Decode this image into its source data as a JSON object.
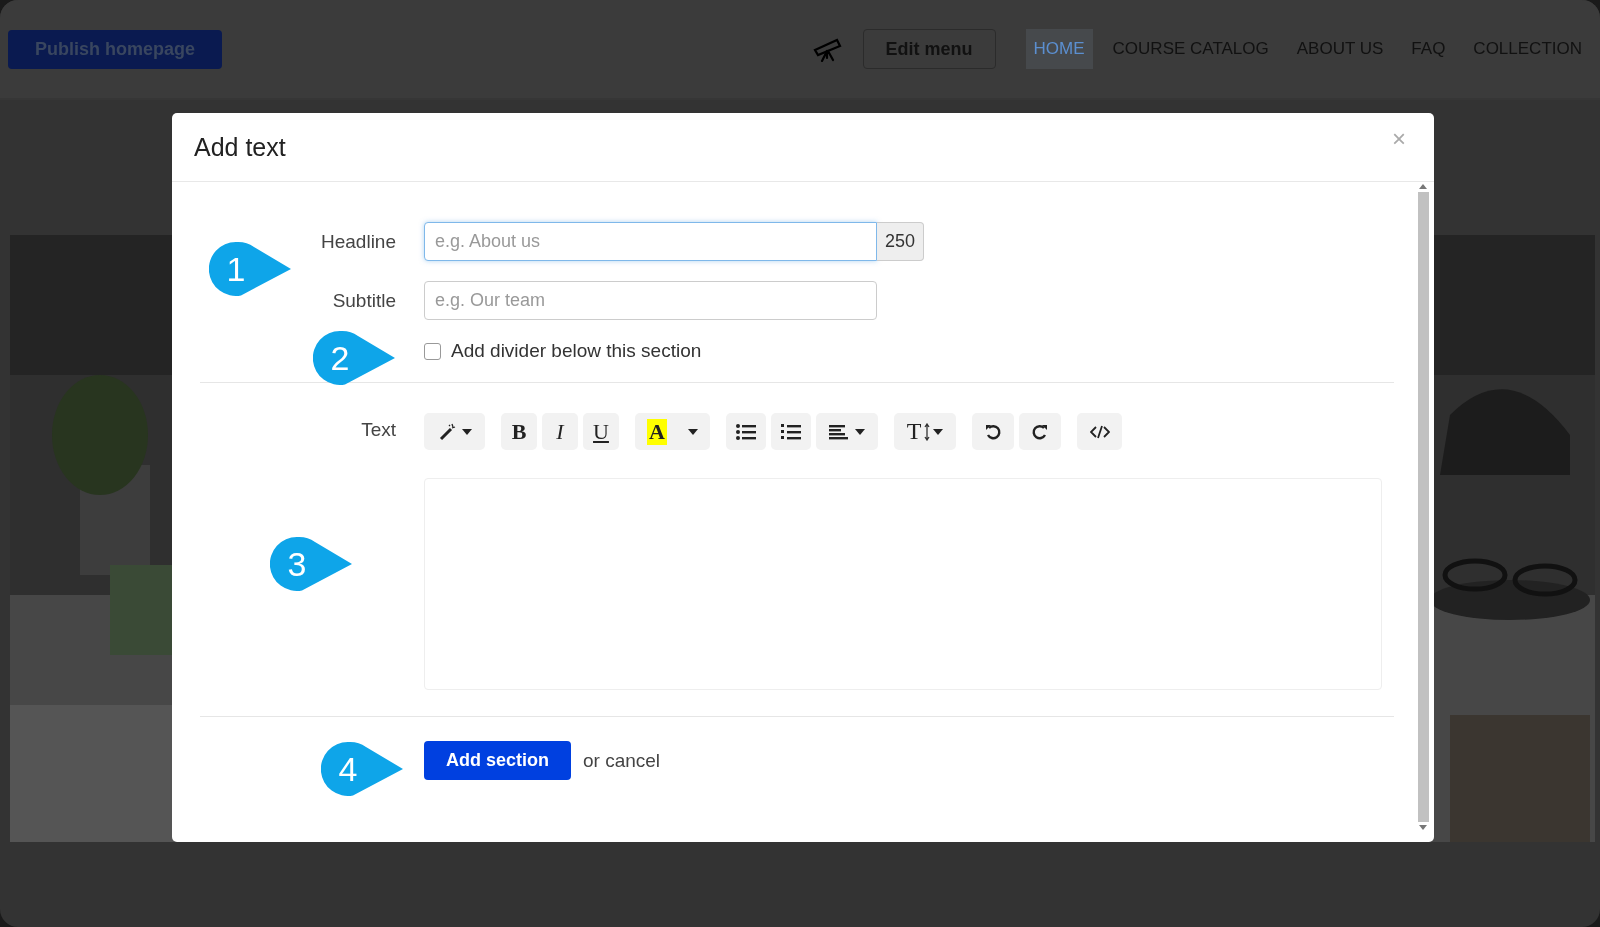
{
  "header": {
    "publish_button": "Publish homepage",
    "edit_menu_button": "Edit menu",
    "nav": [
      {
        "label": "HOME",
        "selected": true
      },
      {
        "label": "COURSE CATALOG",
        "selected": false
      },
      {
        "label": "ABOUT US",
        "selected": false
      },
      {
        "label": "FAQ",
        "selected": false
      },
      {
        "label": "COLLECTION",
        "selected": false
      }
    ]
  },
  "modal": {
    "title": "Add text",
    "close": "×",
    "headline": {
      "label": "Headline",
      "placeholder": "e.g. About us",
      "counter": "250"
    },
    "subtitle": {
      "label": "Subtitle",
      "placeholder": "e.g. Our team"
    },
    "divider_option": {
      "label": "Add divider below this section",
      "checked": false
    },
    "editor": {
      "label": "Text",
      "groups": [
        [
          {
            "kind": "magic"
          }
        ],
        [
          {
            "kind": "bold",
            "glyph": "B"
          },
          {
            "kind": "italic",
            "glyph": "I"
          },
          {
            "kind": "underline",
            "glyph": "U"
          }
        ],
        [
          {
            "kind": "color",
            "glyph": "A"
          }
        ],
        [
          {
            "kind": "bullets"
          },
          {
            "kind": "numbers"
          },
          {
            "kind": "align"
          }
        ],
        [
          {
            "kind": "size",
            "glyph": "T"
          }
        ],
        [
          {
            "kind": "undo"
          },
          {
            "kind": "redo"
          }
        ],
        [
          {
            "kind": "code"
          }
        ]
      ]
    },
    "submit_button": "Add section",
    "cancel_text": "or cancel",
    "callouts": [
      {
        "number": "1"
      },
      {
        "number": "2"
      },
      {
        "number": "3"
      },
      {
        "number": "4"
      }
    ]
  }
}
